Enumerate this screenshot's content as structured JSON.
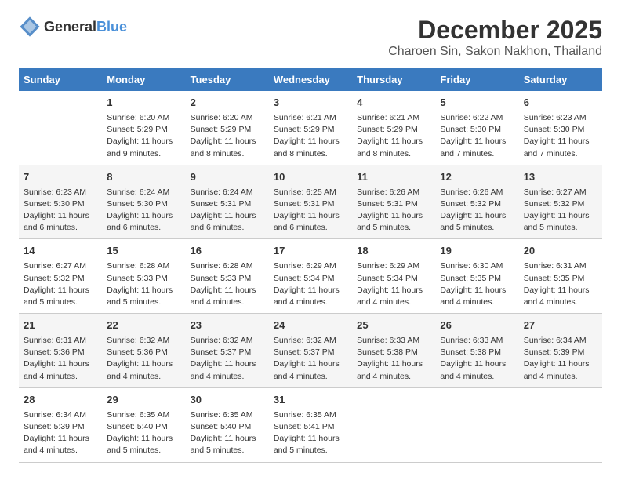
{
  "logo": {
    "text_general": "General",
    "text_blue": "Blue"
  },
  "title": "December 2025",
  "subtitle": "Charoen Sin, Sakon Nakhon, Thailand",
  "days_of_week": [
    "Sunday",
    "Monday",
    "Tuesday",
    "Wednesday",
    "Thursday",
    "Friday",
    "Saturday"
  ],
  "weeks": [
    [
      {
        "day": "",
        "sunrise": "",
        "sunset": "",
        "daylight": ""
      },
      {
        "day": "1",
        "sunrise": "Sunrise: 6:20 AM",
        "sunset": "Sunset: 5:29 PM",
        "daylight": "Daylight: 11 hours and 9 minutes."
      },
      {
        "day": "2",
        "sunrise": "Sunrise: 6:20 AM",
        "sunset": "Sunset: 5:29 PM",
        "daylight": "Daylight: 11 hours and 8 minutes."
      },
      {
        "day": "3",
        "sunrise": "Sunrise: 6:21 AM",
        "sunset": "Sunset: 5:29 PM",
        "daylight": "Daylight: 11 hours and 8 minutes."
      },
      {
        "day": "4",
        "sunrise": "Sunrise: 6:21 AM",
        "sunset": "Sunset: 5:29 PM",
        "daylight": "Daylight: 11 hours and 8 minutes."
      },
      {
        "day": "5",
        "sunrise": "Sunrise: 6:22 AM",
        "sunset": "Sunset: 5:30 PM",
        "daylight": "Daylight: 11 hours and 7 minutes."
      },
      {
        "day": "6",
        "sunrise": "Sunrise: 6:23 AM",
        "sunset": "Sunset: 5:30 PM",
        "daylight": "Daylight: 11 hours and 7 minutes."
      }
    ],
    [
      {
        "day": "7",
        "sunrise": "Sunrise: 6:23 AM",
        "sunset": "Sunset: 5:30 PM",
        "daylight": "Daylight: 11 hours and 6 minutes."
      },
      {
        "day": "8",
        "sunrise": "Sunrise: 6:24 AM",
        "sunset": "Sunset: 5:30 PM",
        "daylight": "Daylight: 11 hours and 6 minutes."
      },
      {
        "day": "9",
        "sunrise": "Sunrise: 6:24 AM",
        "sunset": "Sunset: 5:31 PM",
        "daylight": "Daylight: 11 hours and 6 minutes."
      },
      {
        "day": "10",
        "sunrise": "Sunrise: 6:25 AM",
        "sunset": "Sunset: 5:31 PM",
        "daylight": "Daylight: 11 hours and 6 minutes."
      },
      {
        "day": "11",
        "sunrise": "Sunrise: 6:26 AM",
        "sunset": "Sunset: 5:31 PM",
        "daylight": "Daylight: 11 hours and 5 minutes."
      },
      {
        "day": "12",
        "sunrise": "Sunrise: 6:26 AM",
        "sunset": "Sunset: 5:32 PM",
        "daylight": "Daylight: 11 hours and 5 minutes."
      },
      {
        "day": "13",
        "sunrise": "Sunrise: 6:27 AM",
        "sunset": "Sunset: 5:32 PM",
        "daylight": "Daylight: 11 hours and 5 minutes."
      }
    ],
    [
      {
        "day": "14",
        "sunrise": "Sunrise: 6:27 AM",
        "sunset": "Sunset: 5:32 PM",
        "daylight": "Daylight: 11 hours and 5 minutes."
      },
      {
        "day": "15",
        "sunrise": "Sunrise: 6:28 AM",
        "sunset": "Sunset: 5:33 PM",
        "daylight": "Daylight: 11 hours and 5 minutes."
      },
      {
        "day": "16",
        "sunrise": "Sunrise: 6:28 AM",
        "sunset": "Sunset: 5:33 PM",
        "daylight": "Daylight: 11 hours and 4 minutes."
      },
      {
        "day": "17",
        "sunrise": "Sunrise: 6:29 AM",
        "sunset": "Sunset: 5:34 PM",
        "daylight": "Daylight: 11 hours and 4 minutes."
      },
      {
        "day": "18",
        "sunrise": "Sunrise: 6:29 AM",
        "sunset": "Sunset: 5:34 PM",
        "daylight": "Daylight: 11 hours and 4 minutes."
      },
      {
        "day": "19",
        "sunrise": "Sunrise: 6:30 AM",
        "sunset": "Sunset: 5:35 PM",
        "daylight": "Daylight: 11 hours and 4 minutes."
      },
      {
        "day": "20",
        "sunrise": "Sunrise: 6:31 AM",
        "sunset": "Sunset: 5:35 PM",
        "daylight": "Daylight: 11 hours and 4 minutes."
      }
    ],
    [
      {
        "day": "21",
        "sunrise": "Sunrise: 6:31 AM",
        "sunset": "Sunset: 5:36 PM",
        "daylight": "Daylight: 11 hours and 4 minutes."
      },
      {
        "day": "22",
        "sunrise": "Sunrise: 6:32 AM",
        "sunset": "Sunset: 5:36 PM",
        "daylight": "Daylight: 11 hours and 4 minutes."
      },
      {
        "day": "23",
        "sunrise": "Sunrise: 6:32 AM",
        "sunset": "Sunset: 5:37 PM",
        "daylight": "Daylight: 11 hours and 4 minutes."
      },
      {
        "day": "24",
        "sunrise": "Sunrise: 6:32 AM",
        "sunset": "Sunset: 5:37 PM",
        "daylight": "Daylight: 11 hours and 4 minutes."
      },
      {
        "day": "25",
        "sunrise": "Sunrise: 6:33 AM",
        "sunset": "Sunset: 5:38 PM",
        "daylight": "Daylight: 11 hours and 4 minutes."
      },
      {
        "day": "26",
        "sunrise": "Sunrise: 6:33 AM",
        "sunset": "Sunset: 5:38 PM",
        "daylight": "Daylight: 11 hours and 4 minutes."
      },
      {
        "day": "27",
        "sunrise": "Sunrise: 6:34 AM",
        "sunset": "Sunset: 5:39 PM",
        "daylight": "Daylight: 11 hours and 4 minutes."
      }
    ],
    [
      {
        "day": "28",
        "sunrise": "Sunrise: 6:34 AM",
        "sunset": "Sunset: 5:39 PM",
        "daylight": "Daylight: 11 hours and 4 minutes."
      },
      {
        "day": "29",
        "sunrise": "Sunrise: 6:35 AM",
        "sunset": "Sunset: 5:40 PM",
        "daylight": "Daylight: 11 hours and 5 minutes."
      },
      {
        "day": "30",
        "sunrise": "Sunrise: 6:35 AM",
        "sunset": "Sunset: 5:40 PM",
        "daylight": "Daylight: 11 hours and 5 minutes."
      },
      {
        "day": "31",
        "sunrise": "Sunrise: 6:35 AM",
        "sunset": "Sunset: 5:41 PM",
        "daylight": "Daylight: 11 hours and 5 minutes."
      },
      {
        "day": "",
        "sunrise": "",
        "sunset": "",
        "daylight": ""
      },
      {
        "day": "",
        "sunrise": "",
        "sunset": "",
        "daylight": ""
      },
      {
        "day": "",
        "sunrise": "",
        "sunset": "",
        "daylight": ""
      }
    ]
  ]
}
